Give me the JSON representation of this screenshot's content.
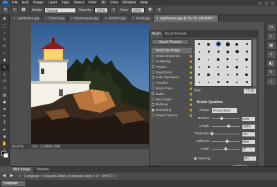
{
  "app": {
    "logo": "Ps"
  },
  "menu": [
    "File",
    "Edit",
    "Image",
    "Layer",
    "Type",
    "Select",
    "Filter",
    "3D",
    "View",
    "Window",
    "Help"
  ],
  "options": {
    "mode_label": "Mode:",
    "mode_value": "Normal",
    "opacity_label": "Opacity:",
    "opacity_value": "100%",
    "flow_label": "Flow:",
    "flow_value": "100%"
  },
  "tabs": [
    {
      "label": "Lighthouse.jpg",
      "close": "×"
    },
    {
      "label": "Desert.jpg",
      "close": "×"
    },
    {
      "label": "Hydrangeas.jpg",
      "close": "×"
    },
    {
      "label": "Jellyfish.jpg",
      "close": "×"
    },
    {
      "label": "Koala.jpg",
      "close": "×"
    },
    {
      "label": "Lighthouse.jpg @ 66.7% (RGB/8#) *",
      "close": "×"
    }
  ],
  "status": {
    "zoom": "66.67%",
    "doc": "Doc: 2.25M/2.25M"
  },
  "bottom_tabs": [
    "Mini Bridge",
    "Timeline"
  ],
  "bridge": {
    "crumbs": "Computer  >  Shared Folders (\\\\vmware-host)  >  Z:  >  HOST C",
    "computer_label": "Computer"
  },
  "brush_panel": {
    "tabs": [
      "Brush",
      "Brush Presets"
    ],
    "presets_button": "Brush Presets",
    "items": [
      {
        "label": "Brush Tip Shape",
        "checkbox": false,
        "checked": false,
        "active": true
      },
      {
        "label": "Shape Dynamics",
        "checkbox": true,
        "checked": false
      },
      {
        "label": "Scattering",
        "checkbox": true,
        "checked": false
      },
      {
        "label": "Texture",
        "checkbox": true,
        "checked": false
      },
      {
        "label": "Dual Brush",
        "checkbox": true,
        "checked": false
      },
      {
        "label": "Color Dynamics",
        "checkbox": true,
        "checked": false
      },
      {
        "label": "Transfer",
        "checkbox": true,
        "checked": false
      },
      {
        "label": "Brush Pose",
        "checkbox": true,
        "checked": false
      },
      {
        "label": "Noise",
        "checkbox": true,
        "checked": false
      },
      {
        "label": "Wet Edges",
        "checkbox": true,
        "checked": false
      },
      {
        "label": "Build-up",
        "checkbox": true,
        "checked": false
      },
      {
        "label": "Smoothing",
        "checkbox": true,
        "checked": true
      },
      {
        "label": "Protect Texture",
        "checkbox": true,
        "checked": false
      }
    ],
    "size_label": "Size",
    "size_value": "71 px",
    "bristle_title": "Bristle Qualities",
    "shape_label": "Shape:",
    "shape_value": "Round Blunt",
    "sliders": [
      {
        "label": "Bristles:",
        "value": "34%",
        "pct": 34
      },
      {
        "label": "Length:",
        "value": "119%",
        "pct": 60
      },
      {
        "label": "Thickness:",
        "value": "1%",
        "pct": 1
      },
      {
        "label": "Stiffness:",
        "value": "55%",
        "pct": 55
      },
      {
        "label": "Angle:",
        "value": "0°",
        "pct": 50
      }
    ],
    "spacing_label": "Spacing",
    "spacing_value": "2%"
  }
}
